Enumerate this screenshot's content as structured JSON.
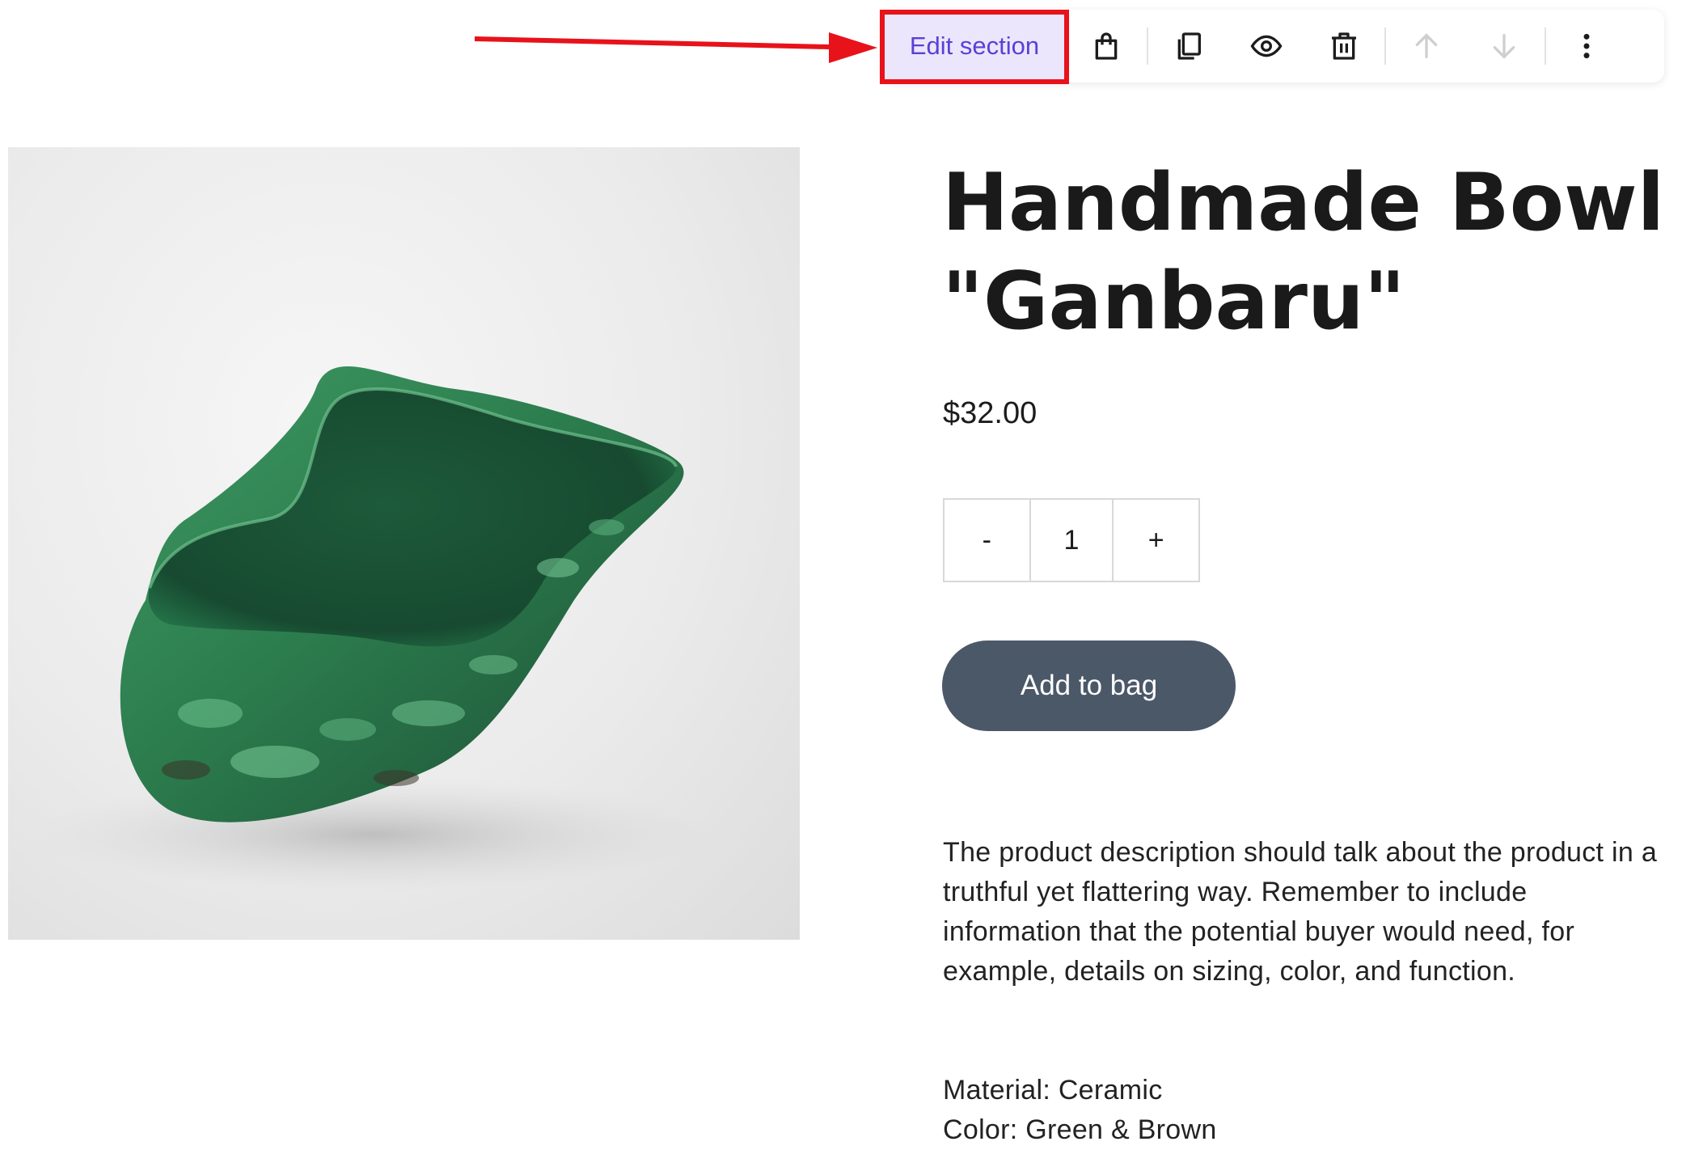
{
  "toolbar": {
    "edit_section_label": "Edit section",
    "buttons": [
      {
        "name": "bag-icon",
        "enabled": true
      },
      {
        "name": "duplicate-icon",
        "enabled": true
      },
      {
        "name": "eye-icon",
        "enabled": true
      },
      {
        "name": "trash-icon",
        "enabled": true
      },
      {
        "name": "arrow-up-icon",
        "enabled": false
      },
      {
        "name": "arrow-down-icon",
        "enabled": false
      },
      {
        "name": "more-vertical-icon",
        "enabled": true
      }
    ]
  },
  "annotation": {
    "color": "#e8121a",
    "highlight": "edit-section-button"
  },
  "product": {
    "title_line1": "Handmade Bowl",
    "title_line2": "\"Ganbaru\"",
    "price": "$32.00",
    "quantity": {
      "minus_label": "-",
      "value": "1",
      "plus_label": "+"
    },
    "add_to_bag_label": "Add to bag",
    "description": "The product description should talk about the product in a truthful yet flattering way. Remember to include information that the potential buyer would need, for example, details on sizing, color, and function.",
    "material": "Material: Ceramic",
    "color": "Color: Green & Brown"
  },
  "colors": {
    "accent": "#5b40d6",
    "edit_bg": "#ece6fd",
    "button_bg": "#4b5868",
    "bowl_green": "#2f8a55"
  }
}
